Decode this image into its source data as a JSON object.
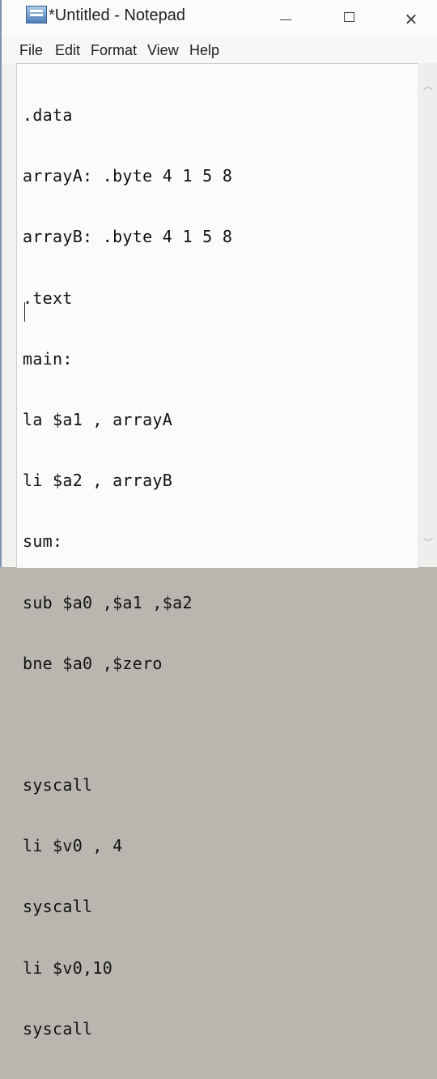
{
  "window": {
    "title": "*Untitled - Notepad",
    "controls": {
      "minimize": "",
      "maximize": "",
      "close": "✕"
    }
  },
  "menu": {
    "file": "File",
    "edit": "Edit",
    "format": "Format",
    "view": "View",
    "help": "Help"
  },
  "editor": {
    "lines": [
      ".data",
      "arrayA: .byte 4 1 5 8",
      "arrayB: .byte 4 1 5 8",
      ".text",
      "main:",
      "la $a1 , arrayA",
      "li $a2 , arrayB",
      "sum:",
      "sub $a0 ,$a1 ,$a2",
      "bne $a0 ,$zero",
      "",
      "syscall",
      "li $v0 , 4",
      "syscall",
      "li $v0,10",
      "syscall"
    ]
  },
  "scrollbar": {
    "up_icon": "︿",
    "down_icon": "﹀"
  },
  "icons": {
    "app": "notepad-icon"
  }
}
